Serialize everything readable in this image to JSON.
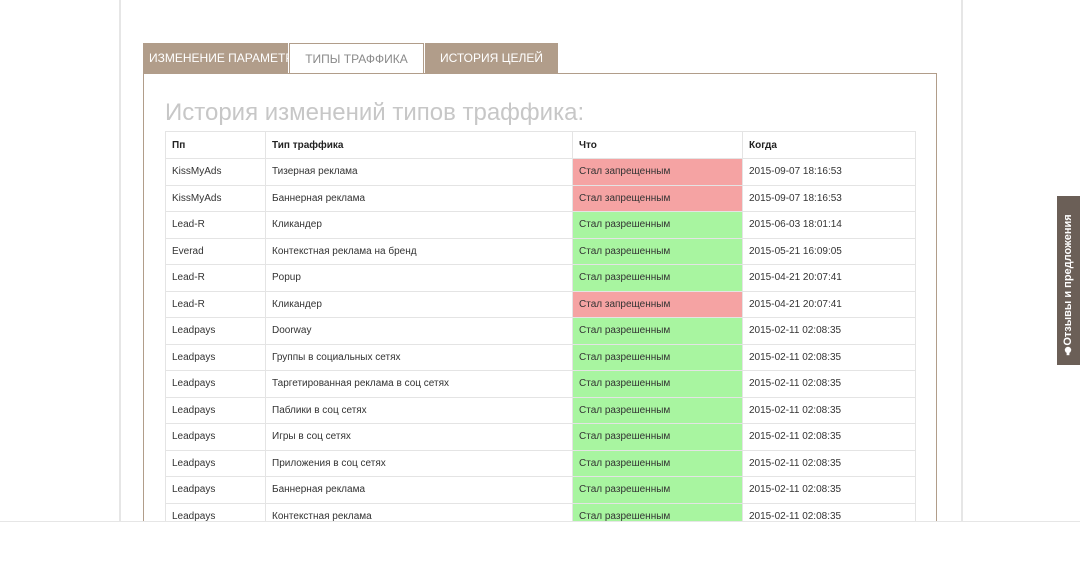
{
  "tabs": [
    {
      "label": "ИЗМЕНЕНИЕ ПАРАМЕТРОВ",
      "active": false
    },
    {
      "label": "ТИПЫ ТРАФФИКА",
      "active": true
    },
    {
      "label": "ИСТОРИЯ ЦЕЛЕЙ",
      "active": false
    }
  ],
  "panel": {
    "title": "История изменений типов траффика:"
  },
  "table": {
    "headers": [
      "Пп",
      "Тип траффика",
      "Что",
      "Когда"
    ],
    "rows": [
      {
        "pp": "KissMyAds",
        "type": "Тизерная реклама",
        "what": "Стал запрещенным",
        "status": "forbidden",
        "when": "2015-09-07 18:16:53"
      },
      {
        "pp": "KissMyAds",
        "type": "Баннерная реклама",
        "what": "Стал запрещенным",
        "status": "forbidden",
        "when": "2015-09-07 18:16:53"
      },
      {
        "pp": "Lead-R",
        "type": "Кликандер",
        "what": "Стал разрешенным",
        "status": "allowed",
        "when": "2015-06-03 18:01:14"
      },
      {
        "pp": "Everad",
        "type": "Контекстная реклама на бренд",
        "what": "Стал разрешенным",
        "status": "allowed",
        "when": "2015-05-21 16:09:05"
      },
      {
        "pp": "Lead-R",
        "type": "Popup",
        "what": "Стал разрешенным",
        "status": "allowed",
        "when": "2015-04-21 20:07:41"
      },
      {
        "pp": "Lead-R",
        "type": "Кликандер",
        "what": "Стал запрещенным",
        "status": "forbidden",
        "when": "2015-04-21 20:07:41"
      },
      {
        "pp": "Leadpays",
        "type": "Doorway",
        "what": "Стал разрешенным",
        "status": "allowed",
        "when": "2015-02-11 02:08:35"
      },
      {
        "pp": "Leadpays",
        "type": "Группы в социальных сетях",
        "what": "Стал разрешенным",
        "status": "allowed",
        "when": "2015-02-11 02:08:35"
      },
      {
        "pp": "Leadpays",
        "type": "Таргетированная реклама в соц сетях",
        "what": "Стал разрешенным",
        "status": "allowed",
        "when": "2015-02-11 02:08:35"
      },
      {
        "pp": "Leadpays",
        "type": "Паблики в соц сетях",
        "what": "Стал разрешенным",
        "status": "allowed",
        "when": "2015-02-11 02:08:35"
      },
      {
        "pp": "Leadpays",
        "type": "Игры в соц сетях",
        "what": "Стал разрешенным",
        "status": "allowed",
        "when": "2015-02-11 02:08:35"
      },
      {
        "pp": "Leadpays",
        "type": "Приложения в соц сетях",
        "what": "Стал разрешенным",
        "status": "allowed",
        "when": "2015-02-11 02:08:35"
      },
      {
        "pp": "Leadpays",
        "type": "Баннерная реклама",
        "what": "Стал разрешенным",
        "status": "allowed",
        "when": "2015-02-11 02:08:35"
      },
      {
        "pp": "Leadpays",
        "type": "Контекстная реклама",
        "what": "Стал разрешенным",
        "status": "allowed",
        "when": "2015-02-11 02:08:35"
      }
    ]
  },
  "feedback": {
    "label": "Отзывы и предложения",
    "icon": "lightbulb-icon"
  },
  "colors": {
    "tab_bg": "#b19d8a",
    "forbidden": "#f5a3a3",
    "allowed": "#a8f5a0",
    "feedback_bg": "#6b5f57"
  }
}
